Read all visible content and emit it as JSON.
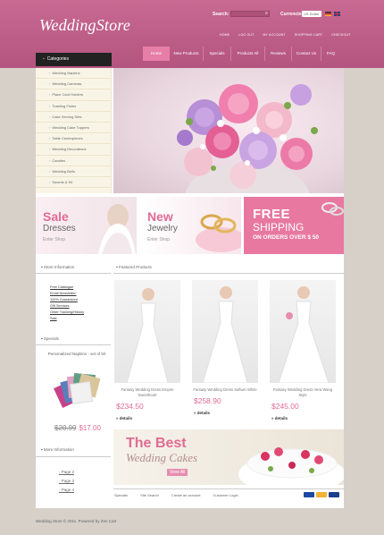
{
  "header": {
    "logo": "WeddingStore",
    "search_label": "Search:",
    "search_icon": "search-icon",
    "currencies_label": "Currencies:",
    "currency": "US Dollar",
    "top_links": [
      "HOME",
      "LOG OUT",
      "MY ACCOUNT",
      "SHOPPING CART",
      "CHECKOUT"
    ]
  },
  "nav": [
    "Home",
    "New Products",
    "Specials",
    "Products All",
    "Reviews",
    "Contact Us",
    "FAQ"
  ],
  "categories": {
    "title": "Categories",
    "items": [
      "Wedding Napkins",
      "Wedding Cameras",
      "Place Card Holders",
      "Toasting Flutes",
      "Cake Serving Sets",
      "Wedding Cake Toppers",
      "Table Centerpieces",
      "Wedding Decorations",
      "Candles",
      "Wedding Bells",
      "Swords & Kit"
    ]
  },
  "banners": {
    "sale": {
      "title": "Sale",
      "sub": "Dresses",
      "link": "Enter Shop"
    },
    "jewelry": {
      "title": "New",
      "sub": "Jewelry",
      "link": "Enter Shop"
    },
    "shipping": {
      "line1": "FREE",
      "line2": "SHIPPING",
      "line3": "ON ORDERS OVER $ 50"
    }
  },
  "store_info": {
    "title": "Store Information",
    "links": [
      "Free Catalogue",
      "Email Newsletter!",
      "100% Guaranteed",
      "Gift Services",
      "Order Tracking/History",
      "Sale"
    ]
  },
  "specials": {
    "title": "Specials",
    "product": "Personalized Napkins - set of 50",
    "old_price": "$20.99",
    "new_price": "$17.00"
  },
  "more_info": {
    "title": "More Information",
    "links": [
      "Page 2",
      "Page 3",
      "Page 4"
    ]
  },
  "featured": {
    "title": "Featured Products",
    "products": [
      {
        "name": "Fantasy Wedding Dress Empire Sweetheart",
        "price": "$234.50",
        "details": "details"
      },
      {
        "name": "Fantasy Wedding Dress Softwin White",
        "price": "$258.90",
        "details": "details"
      },
      {
        "name": "Fantasy Wedding Dress Vera Wang Style",
        "price": "$245.00",
        "details": "details"
      }
    ]
  },
  "cake_banner": {
    "line1": "The Best",
    "line2": "Wedding Cakes",
    "link": "View All"
  },
  "footer": {
    "links": [
      "Specials",
      "Site Search",
      "Create an account",
      "Customer Login"
    ],
    "copyright": "Wedding Store © 2011. Powered by Zen Cart"
  },
  "colors": {
    "accent": "#e06b95",
    "header": "#c06088",
    "background": "#d6d0c8"
  }
}
